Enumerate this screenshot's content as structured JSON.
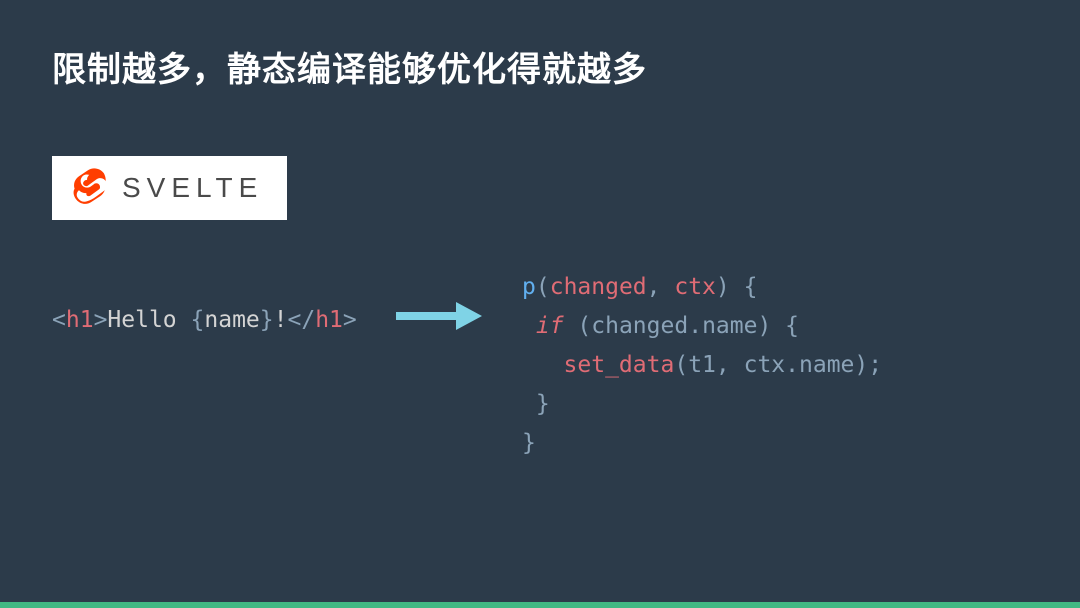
{
  "title": "限制越多，静态编译能够优化得就越多",
  "logo": {
    "name": "svelte",
    "text": "SVELTE"
  },
  "code_left": {
    "tag_open_lt": "<",
    "tag_open_name": "h1",
    "tag_open_gt": ">",
    "greeting": "Hello ",
    "expr_open": "{",
    "expr_name": "name",
    "expr_close": "}",
    "bang": "!",
    "tag_close_lt": "</",
    "tag_close_name": "h1",
    "tag_close_gt": ">"
  },
  "code_right": {
    "fn_name": "p",
    "paren_open": "(",
    "arg1": "changed",
    "comma1": ", ",
    "arg2": "ctx",
    "paren_close": ")",
    "brace_open": " {",
    "if_kw": "if",
    "if_open": " (",
    "cond_obj": "changed",
    "cond_dot": ".",
    "cond_prop": "name",
    "if_close": ") {",
    "call_name": "set_data",
    "call_open": "(",
    "call_arg1": "t1",
    "call_comma": ", ",
    "call_obj": "ctx",
    "call_dot": ".",
    "call_prop": "name",
    "call_close": ");",
    "if_brace_close": "}",
    "fn_brace_close": "}"
  }
}
